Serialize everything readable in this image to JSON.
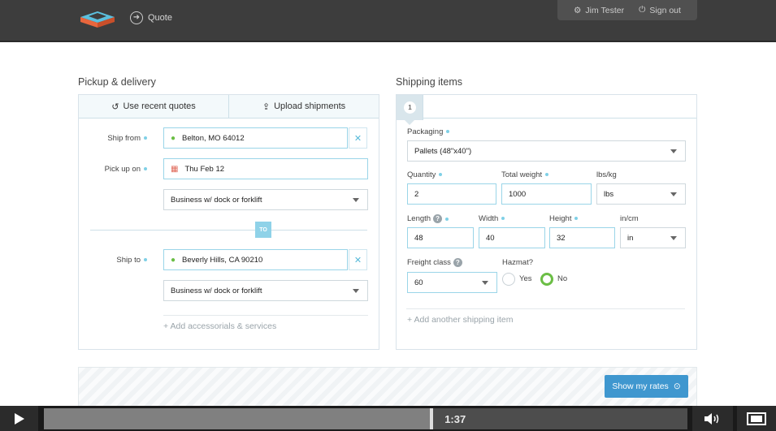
{
  "header": {
    "quote_label": "Quote",
    "user_name": "Jim Tester",
    "signout_label": "Sign out"
  },
  "pickup": {
    "section_title": "Pickup & delivery",
    "tabs": [
      {
        "label": "Use recent quotes",
        "icon": "history-icon"
      },
      {
        "label": "Upload shipments",
        "icon": "upload-icon"
      }
    ],
    "ship_from_label": "Ship from",
    "ship_from_value": "Belton, MO 64012",
    "pickup_on_label": "Pick up on",
    "pickup_on_value": "Thu Feb 12",
    "pickup_type": "Business w/ dock or forklift",
    "to_badge": "TO",
    "ship_to_label": "Ship to",
    "ship_to_value": "Beverly Hills, CA 90210",
    "delivery_type": "Business w/ dock or forklift",
    "add_accessorials": "Add accessorials & services"
  },
  "items": {
    "section_title": "Shipping items",
    "item_number": "1",
    "packaging_label": "Packaging",
    "packaging_value": "Pallets (48\"x40\")",
    "quantity_label": "Quantity",
    "quantity_value": "2",
    "total_weight_label": "Total weight",
    "total_weight_value": "1000",
    "weight_unit_label": "lbs/kg",
    "weight_unit_value": "lbs",
    "length_label": "Length",
    "length_value": "48",
    "width_label": "Width",
    "width_value": "40",
    "height_label": "Height",
    "height_value": "32",
    "dim_unit_label": "in/cm",
    "dim_unit_value": "in",
    "freight_class_label": "Freight class",
    "freight_class_value": "60",
    "hazmat_label": "Hazmat?",
    "hazmat_yes": "Yes",
    "hazmat_no": "No",
    "hazmat_selected": "No",
    "add_item": "Add another shipping item"
  },
  "actions": {
    "show_rates": "Show my rates"
  },
  "video": {
    "time": "1:37",
    "progress": 0.6
  },
  "colors": {
    "accent": "#3f97cf",
    "field_border": "#9ad5e8",
    "required_dot": "#7fd0e6",
    "selected_radio": "#6bbe45",
    "topbar": "#3d3d3d"
  }
}
